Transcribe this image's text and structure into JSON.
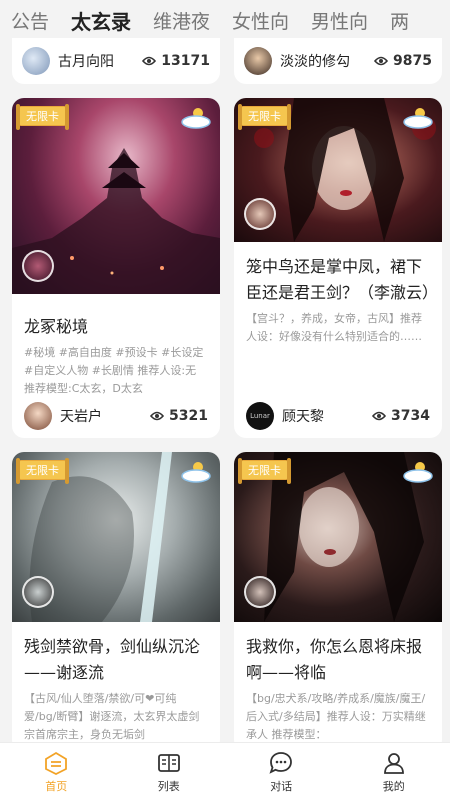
{
  "tabs": [
    "公告",
    "太玄录",
    "维港夜",
    "女性向",
    "男性向",
    "两"
  ],
  "active_tab_index": 1,
  "prev_row": [
    {
      "author": "古月向阳",
      "views": "13171"
    },
    {
      "author": "淡淡的修勾",
      "views": "9875"
    }
  ],
  "cards": [
    {
      "badge": "无限卡",
      "title": "龙冢秘境",
      "desc": "#秘境 #高自由度 #预设卡 #长设定 #自定义人物 #长剧情 推荐人设:无 推荐模型:C太玄，D太玄",
      "author": "天岩户",
      "views": "5321"
    },
    {
      "badge": "无限卡",
      "title": "笼中鸟还是掌中凤，裙下臣还是君王剑？（李澈云）",
      "desc": "【宫斗？，养成，女帝，古风】推荐人设：好像没有什么特别适合的……总之你只要对她好就非常",
      "author": "顾天黎",
      "author_avatar_text": "Lunar",
      "views": "3734"
    },
    {
      "badge": "无限卡",
      "title": "残剑禁欲骨，剑仙纵沉沦——谢逐流",
      "desc": "【古风/仙人堕落/禁欲/可❤可纯爱/bg/断臂】谢逐流，太玄界太虚剑宗首席宗主，身负无垢剑",
      "author": "",
      "views": ""
    },
    {
      "badge": "无限卡",
      "title": "我救你，你怎么恩将床报啊——将临",
      "desc": "【bg/忠犬系/攻略/养成系/魔族/魔王/后入式/多结局】推荐人设：万实精继承人 推荐模型：",
      "author": "",
      "views": ""
    }
  ],
  "bottom_nav": [
    {
      "label": "首页",
      "icon": "home-icon"
    },
    {
      "label": "列表",
      "icon": "list-book-icon"
    },
    {
      "label": "对话",
      "icon": "chat-bubble-icon"
    },
    {
      "label": "我的",
      "icon": "user-icon"
    }
  ],
  "colors": {
    "accent": "#f2a327",
    "badge": "#f5c64f",
    "background": "#f3f3f3"
  }
}
